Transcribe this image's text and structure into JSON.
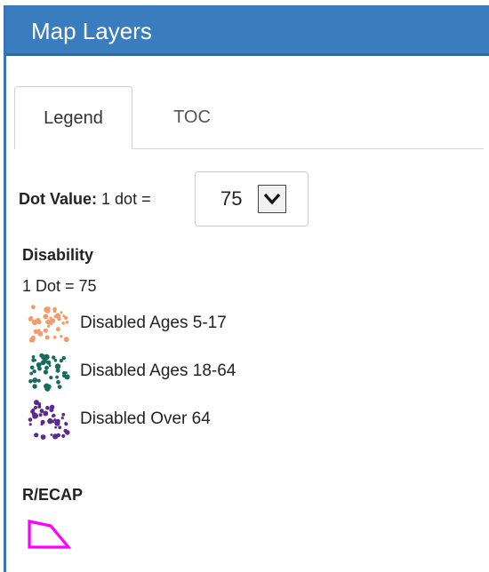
{
  "panel": {
    "title": "Map Layers"
  },
  "tabs": [
    {
      "label": "Legend",
      "active": true
    },
    {
      "label": "TOC",
      "active": false
    }
  ],
  "dot_value": {
    "label_bold": "Dot Value:",
    "label_rest": "1 dot =",
    "selected": "75"
  },
  "sections": {
    "disability": {
      "title": "Disability",
      "subtitle": "1 Dot = 75",
      "items": [
        {
          "label": "Disabled Ages 5-17",
          "color": "#f59a6b",
          "icon": "dot-density-swatch"
        },
        {
          "label": "Disabled Ages 18-64",
          "color": "#1a6b5e",
          "icon": "dot-density-swatch"
        },
        {
          "label": "Disabled Over 64",
          "color": "#5a2b8c",
          "icon": "dot-density-swatch"
        }
      ]
    },
    "recap": {
      "title": "R/ECAP",
      "outline_color": "#ff00ff",
      "icon": "polygon-outline"
    }
  }
}
